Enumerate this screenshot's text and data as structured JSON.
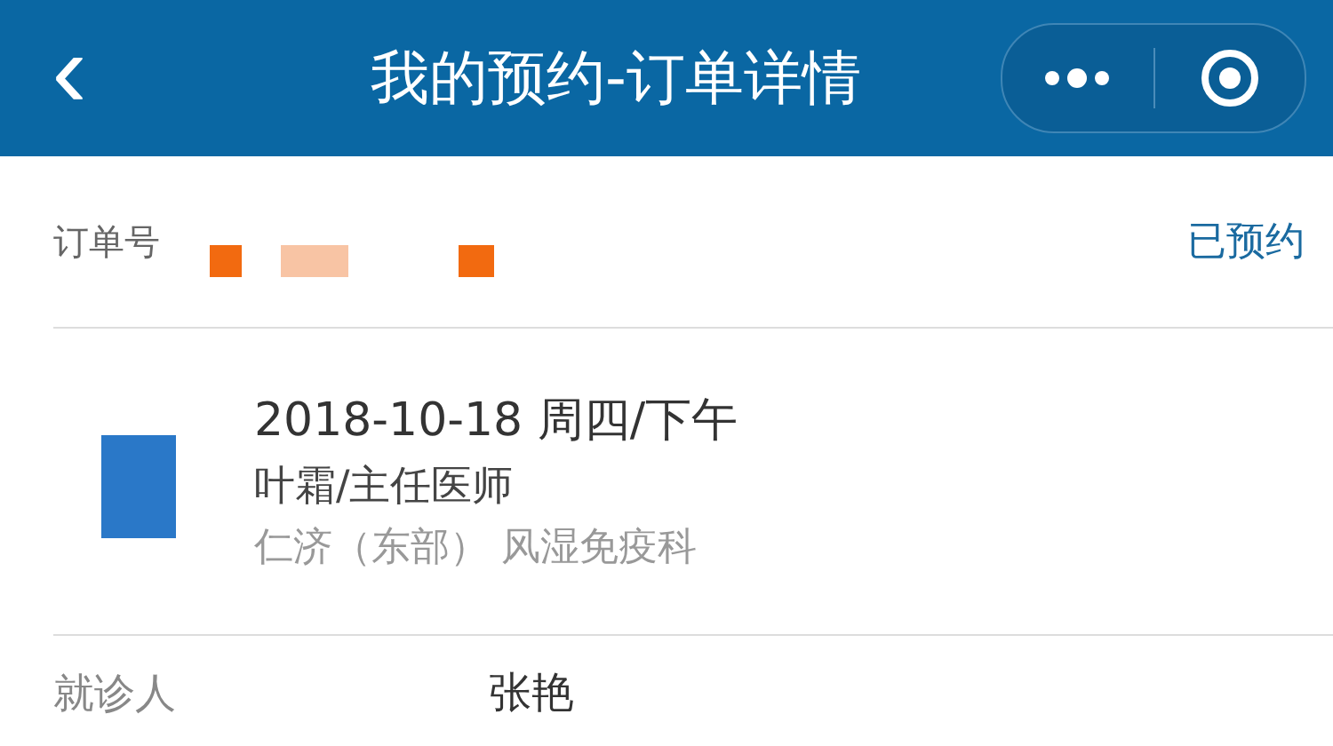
{
  "nav_bar": {
    "back": "‹",
    "title": "我的预约-订单详情"
  },
  "order": {
    "label": "订单号",
    "status": "已预约"
  },
  "appointment": {
    "date": "2018-10-18 周四/下午",
    "doctor": "叶霜/主任医师",
    "department": "仁济（东部） 风湿免疫科"
  },
  "fields": [
    {
      "label": "就诊人",
      "value": "张艳"
    }
  ]
}
